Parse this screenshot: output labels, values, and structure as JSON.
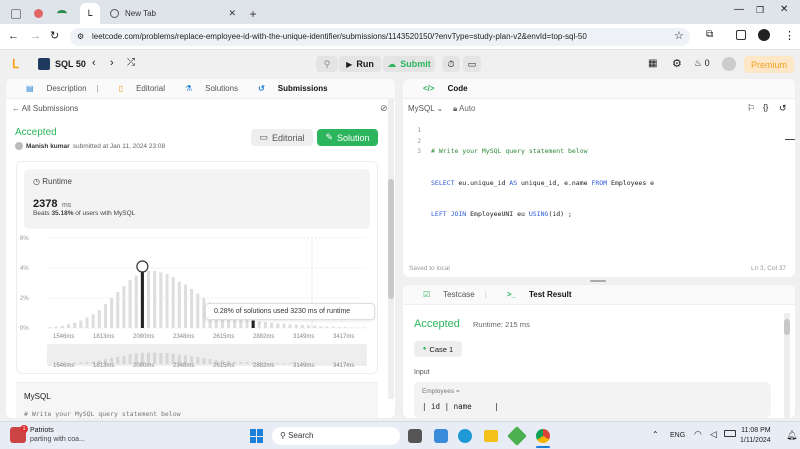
{
  "browser": {
    "tabs": [
      {
        "label": ""
      },
      {
        "label": ""
      },
      {
        "label": ""
      },
      {
        "label": "New Tab"
      }
    ],
    "url": "leetcode.com/problems/replace-employee-id-with-the-unique-identifier/submissions/1143520150/?envType=study-plan-v2&envId=top-sql-50"
  },
  "lc": {
    "study_plan": "SQL 50",
    "run": "Run",
    "submit": "Submit",
    "streak": "0",
    "premium": "Premium"
  },
  "left": {
    "tabs": [
      "Description",
      "Editorial",
      "Solutions",
      "Submissions"
    ],
    "back": "All Submissions",
    "status": "Accepted",
    "user": "Manish kumar",
    "submitted": "submitted at Jan 11, 2024 23:08",
    "editorial_btn": "Editorial",
    "solution_btn": "Solution",
    "runtime_label": "Runtime",
    "runtime_value": "2378",
    "runtime_unit": "ms",
    "beats_pct": "35.18%",
    "beats_rest": "of users with MySQL",
    "tooltip": "0.28% of solutions used 3230 ms of runtime",
    "lang_label": "MySQL",
    "code_preview": "# Write your MySQL query statement below"
  },
  "chart_data": {
    "type": "bar",
    "ylabel": "",
    "yticks": [
      "6%",
      "4%",
      "2%",
      "0%"
    ],
    "ylim": [
      0,
      6
    ],
    "xticks": [
      "1546ms",
      "1813ms",
      "2080ms",
      "2348ms",
      "2615ms",
      "2882ms",
      "3149ms",
      "3417ms"
    ],
    "values": [
      0.05,
      0.1,
      0.15,
      0.25,
      0.35,
      0.5,
      0.7,
      0.9,
      1.2,
      1.6,
      2.0,
      2.4,
      2.8,
      3.2,
      3.5,
      3.7,
      3.8,
      3.8,
      3.7,
      3.6,
      3.4,
      3.1,
      2.9,
      2.6,
      2.3,
      2.0,
      1.7,
      1.4,
      1.2,
      1.0,
      0.85,
      0.7,
      0.6,
      0.5,
      0.45,
      0.4,
      0.35,
      0.3,
      0.28,
      0.25,
      0.22,
      0.2,
      0.18,
      0.15,
      0.12,
      0.1,
      0.08,
      0.06,
      0.05,
      0.04,
      0.03,
      0.03
    ],
    "highlight_index": 15,
    "marker_index": 33
  },
  "right": {
    "code_tab": "Code",
    "lang": "MySQL",
    "auto": "Auto",
    "code_lines": [
      {
        "n": "1",
        "text": "# Write your MySQL query statement below"
      },
      {
        "n": "2",
        "text": "SELECT eu.unique_id AS unique_id, e.name FROM Employees e"
      },
      {
        "n": "3",
        "text": "LEFT JOIN EmployeeUNI eu USING(id) ;"
      }
    ],
    "saved": "Saved to local",
    "cursor": "Ln 3, Col 37",
    "testcase_tab": "Testcase",
    "result_tab": "Test Result",
    "result_status": "Accepted",
    "result_runtime": "Runtime: 215 ms",
    "case": "Case 1",
    "input_label": "Input",
    "input_table": "Employees =",
    "input_row": "| id | name     |"
  },
  "taskbar": {
    "notif_title": "Patriots",
    "notif_sub": "parting with coa...",
    "search": "Search",
    "lang": "ENG",
    "time": "11:08 PM",
    "date": "1/11/2024"
  }
}
